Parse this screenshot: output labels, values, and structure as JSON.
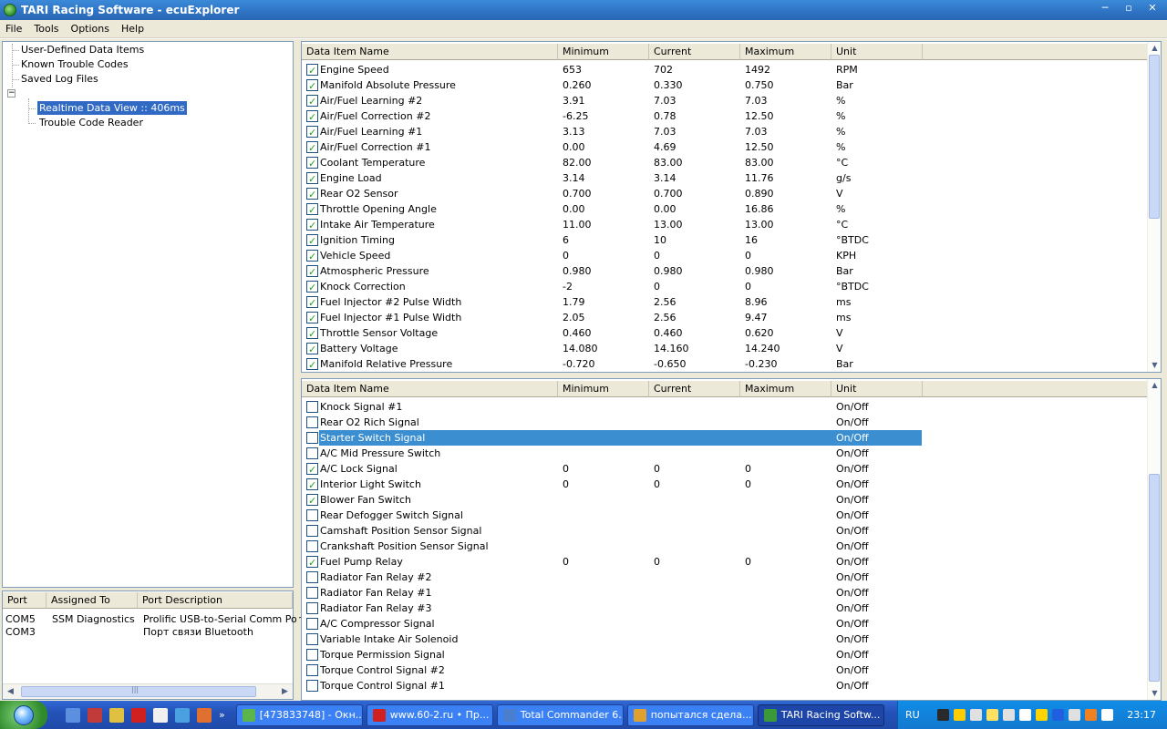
{
  "window": {
    "title": "TARI Racing Software - ecuExplorer",
    "minimize": "─",
    "maximize": "▫",
    "close": "✕"
  },
  "menu": [
    "File",
    "Tools",
    "Options",
    "Help"
  ],
  "tree": {
    "items": [
      "User-Defined Data Items",
      "Known Trouble Codes",
      "Saved Log Files"
    ],
    "collapse_glyph": "−",
    "children": [
      "Realtime Data View :: 406ms",
      "Trouble Code Reader"
    ]
  },
  "ports": {
    "headers": [
      "Port",
      "Assigned To",
      "Port Description"
    ],
    "rows": [
      {
        "port": "COM5",
        "assigned": "SSM Diagnostics",
        "desc": "Prolific USB-to-Serial Comm Port"
      },
      {
        "port": "COM3",
        "assigned": "",
        "desc": "Порт связи Bluetooth"
      }
    ],
    "scroll_left": "◀",
    "scroll_right": "▶",
    "thumb_grip": "|||"
  },
  "table1": {
    "headers": [
      "Data Item Name",
      "Minimum",
      "Current",
      "Maximum",
      "Unit"
    ],
    "rows": [
      {
        "name": "Engine Speed",
        "checked": true,
        "min": "653",
        "cur": "702",
        "max": "1492",
        "unit": "RPM"
      },
      {
        "name": "Manifold Absolute Pressure",
        "checked": true,
        "min": "0.260",
        "cur": "0.330",
        "max": "0.750",
        "unit": "Bar"
      },
      {
        "name": "Air/Fuel Learning #2",
        "checked": true,
        "min": "3.91",
        "cur": "7.03",
        "max": "7.03",
        "unit": "%"
      },
      {
        "name": "Air/Fuel Correction #2",
        "checked": true,
        "min": "-6.25",
        "cur": "0.78",
        "max": "12.50",
        "unit": "%"
      },
      {
        "name": "Air/Fuel Learning #1",
        "checked": true,
        "min": "3.13",
        "cur": "7.03",
        "max": "7.03",
        "unit": "%"
      },
      {
        "name": "Air/Fuel Correction #1",
        "checked": true,
        "min": "0.00",
        "cur": "4.69",
        "max": "12.50",
        "unit": "%"
      },
      {
        "name": "Coolant Temperature",
        "checked": true,
        "min": "82.00",
        "cur": "83.00",
        "max": "83.00",
        "unit": "°C"
      },
      {
        "name": "Engine Load",
        "checked": true,
        "min": "3.14",
        "cur": "3.14",
        "max": "11.76",
        "unit": "g/s"
      },
      {
        "name": "Rear O2 Sensor",
        "checked": true,
        "min": "0.700",
        "cur": "0.700",
        "max": "0.890",
        "unit": "V"
      },
      {
        "name": "Throttle Opening Angle",
        "checked": true,
        "min": "0.00",
        "cur": "0.00",
        "max": "16.86",
        "unit": "%"
      },
      {
        "name": "Intake Air Temperature",
        "checked": true,
        "min": "11.00",
        "cur": "13.00",
        "max": "13.00",
        "unit": "°C"
      },
      {
        "name": "Ignition Timing",
        "checked": true,
        "min": "6",
        "cur": "10",
        "max": "16",
        "unit": "°BTDC"
      },
      {
        "name": "Vehicle Speed",
        "checked": true,
        "min": "0",
        "cur": "0",
        "max": "0",
        "unit": "KPH"
      },
      {
        "name": "Atmospheric Pressure",
        "checked": true,
        "min": "0.980",
        "cur": "0.980",
        "max": "0.980",
        "unit": "Bar"
      },
      {
        "name": "Knock Correction",
        "checked": true,
        "min": "-2",
        "cur": "0",
        "max": "0",
        "unit": "°BTDC"
      },
      {
        "name": "Fuel Injector #2 Pulse Width",
        "checked": true,
        "min": "1.79",
        "cur": "2.56",
        "max": "8.96",
        "unit": "ms"
      },
      {
        "name": "Fuel Injector #1 Pulse Width",
        "checked": true,
        "min": "2.05",
        "cur": "2.56",
        "max": "9.47",
        "unit": "ms"
      },
      {
        "name": "Throttle Sensor Voltage",
        "checked": true,
        "min": "0.460",
        "cur": "0.460",
        "max": "0.620",
        "unit": "V"
      },
      {
        "name": "Battery Voltage",
        "checked": true,
        "min": "14.080",
        "cur": "14.160",
        "max": "14.240",
        "unit": "V"
      },
      {
        "name": "Manifold Relative Pressure",
        "checked": true,
        "min": "-0.720",
        "cur": "-0.650",
        "max": "-0.230",
        "unit": "Bar"
      }
    ]
  },
  "table2": {
    "headers": [
      "Data Item Name",
      "Minimum",
      "Current",
      "Maximum",
      "Unit"
    ],
    "selected_index": 2,
    "rows": [
      {
        "name": "Knock Signal #1",
        "checked": false,
        "min": "",
        "cur": "",
        "max": "",
        "unit": "On/Off"
      },
      {
        "name": "Rear O2 Rich Signal",
        "checked": false,
        "min": "",
        "cur": "",
        "max": "",
        "unit": "On/Off"
      },
      {
        "name": "Starter Switch Signal",
        "checked": false,
        "min": "",
        "cur": "",
        "max": "",
        "unit": "On/Off"
      },
      {
        "name": "A/C Mid Pressure Switch",
        "checked": false,
        "min": "",
        "cur": "",
        "max": "",
        "unit": "On/Off"
      },
      {
        "name": "A/C Lock Signal",
        "checked": true,
        "min": "0",
        "cur": "0",
        "max": "0",
        "unit": "On/Off"
      },
      {
        "name": "Interior Light Switch",
        "checked": true,
        "min": "0",
        "cur": "0",
        "max": "0",
        "unit": "On/Off"
      },
      {
        "name": "Blower Fan Switch",
        "checked": true,
        "min": "",
        "cur": "",
        "max": "",
        "unit": "On/Off"
      },
      {
        "name": "Rear Defogger Switch Signal",
        "checked": false,
        "min": "",
        "cur": "",
        "max": "",
        "unit": "On/Off"
      },
      {
        "name": "Camshaft Position Sensor Signal",
        "checked": false,
        "min": "",
        "cur": "",
        "max": "",
        "unit": "On/Off"
      },
      {
        "name": "Crankshaft Position Sensor Signal",
        "checked": false,
        "min": "",
        "cur": "",
        "max": "",
        "unit": "On/Off"
      },
      {
        "name": "Fuel Pump Relay",
        "checked": true,
        "min": "0",
        "cur": "0",
        "max": "0",
        "unit": "On/Off"
      },
      {
        "name": "Radiator Fan Relay #2",
        "checked": false,
        "min": "",
        "cur": "",
        "max": "",
        "unit": "On/Off"
      },
      {
        "name": "Radiator Fan Relay #1",
        "checked": false,
        "min": "",
        "cur": "",
        "max": "",
        "unit": "On/Off"
      },
      {
        "name": "Radiator Fan Relay #3",
        "checked": false,
        "min": "",
        "cur": "",
        "max": "",
        "unit": "On/Off"
      },
      {
        "name": "A/C Compressor Signal",
        "checked": false,
        "min": "",
        "cur": "",
        "max": "",
        "unit": "On/Off"
      },
      {
        "name": "Variable Intake Air Solenoid",
        "checked": false,
        "min": "",
        "cur": "",
        "max": "",
        "unit": "On/Off"
      },
      {
        "name": "Torque Permission Signal",
        "checked": false,
        "min": "",
        "cur": "",
        "max": "",
        "unit": "On/Off"
      },
      {
        "name": "Torque Control Signal #2",
        "checked": false,
        "min": "",
        "cur": "",
        "max": "",
        "unit": "On/Off"
      },
      {
        "name": "Torque Control Signal #1",
        "checked": false,
        "min": "",
        "cur": "",
        "max": "",
        "unit": "On/Off"
      }
    ]
  },
  "scroll": {
    "up": "▲",
    "down": "▼"
  },
  "taskbar": {
    "overflow": "»",
    "tasks": [
      {
        "label": "[473833748] - Окн...",
        "icon_color": "#5bb54a"
      },
      {
        "label": "www.60-2.ru • Пр...",
        "icon_color": "#d12020"
      },
      {
        "label": "Total Commander 6...",
        "icon_color": "#4a7fd0"
      },
      {
        "label": "попытался сдела...",
        "icon_color": "#e0a030"
      },
      {
        "label": "TARI Racing Softw...",
        "icon_color": "#3a9a3a",
        "active": true
      }
    ],
    "quick_launch_colors": [
      "#5d8fe0",
      "#c23b3b",
      "#e0c040",
      "#d12020",
      "#f0f0f0",
      "#4aa0e0",
      "#e07030"
    ],
    "language": "RU",
    "tray_icon_colors": [
      "#2a2a2a",
      "#ffcc00",
      "#e0e0e0",
      "#ffe060",
      "#e0e0e0",
      "#ffffff",
      "#ffd400",
      "#2060e0",
      "#e0e0e0",
      "#f08020",
      "#ffffff"
    ],
    "clock": "23:17"
  }
}
